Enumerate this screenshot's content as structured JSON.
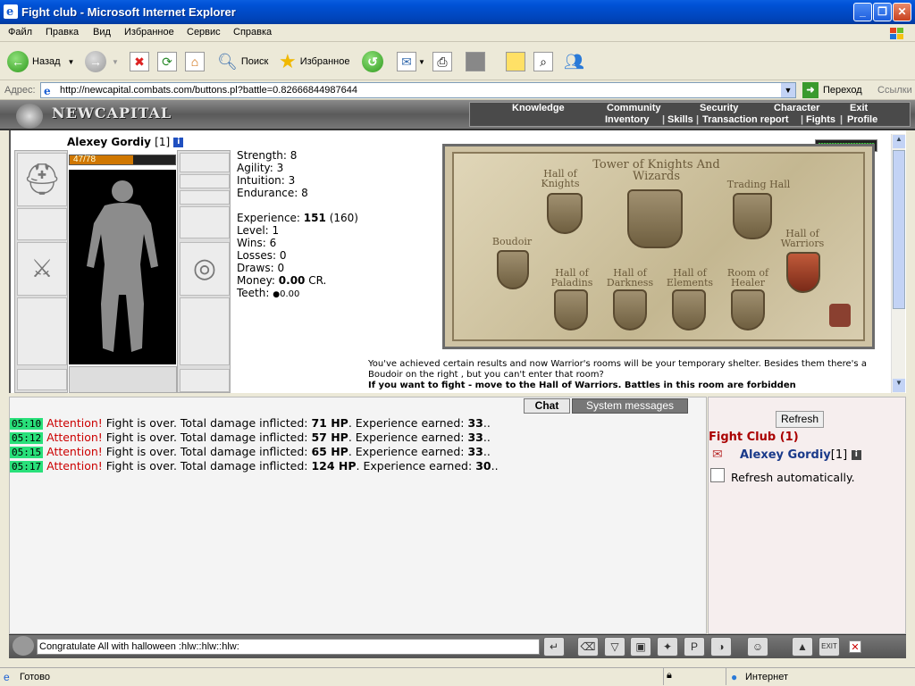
{
  "window": {
    "title": "Fight club - Microsoft Internet Explorer"
  },
  "menu": [
    "Файл",
    "Правка",
    "Вид",
    "Избранное",
    "Сервис",
    "Справка"
  ],
  "toolbar": {
    "back": "Назад",
    "search": "Поиск",
    "favorites": "Избранное"
  },
  "address": {
    "label": "Адрес:",
    "url": "http://newcapital.combats.com/buttons.pl?battle=0.82666844987644",
    "go": "Переход",
    "links": "Ссылки"
  },
  "game": {
    "logo": "NEWCAPITAL",
    "nav_top": [
      "Knowledge",
      "Community",
      "Security",
      "Character",
      "Exit"
    ],
    "nav_sub": [
      "Inventory",
      "Skills",
      "Transaction report",
      "Fights",
      "Profile"
    ]
  },
  "character": {
    "name": "Alexey Gordiy",
    "level_tag": "[1]",
    "hp": "47/78",
    "hp_ratio": 0.6,
    "stats": {
      "strength": "Strength: 8",
      "agility": "Agility: 3",
      "intuition": "Intuition: 3",
      "endurance": "Endurance: 8"
    },
    "experience_label": "Experience:",
    "experience": "151",
    "experience_next": "(160)",
    "level": "Level: 1",
    "wins": "Wins: 6",
    "losses": "Losses: 0",
    "draws": "Draws: 0",
    "money_label": "Money:",
    "money": "0.00",
    "money_unit": "CR.",
    "teeth_label": "Teeth:",
    "teeth": "0.00"
  },
  "map": {
    "rooms": {
      "knights": "Hall of Knights",
      "tower": "Tower of Knights And Wizards",
      "trading": "Trading Hall",
      "boudoir": "Boudoir",
      "warriors": "Hall of Warriors",
      "paladins": "Hall of Paladins",
      "darkness": "Hall of Darkness",
      "elements": "Hall of Elements",
      "healer": "Room of Healer"
    },
    "message": "You've achieved certain results and now Warrior's rooms will be your temporary shelter. Besides them there's a Boudoir on the right , but you can't enter that room?",
    "message_bold": "If you want to fight - move to the Hall of Warriors. Battles in this room are forbidden"
  },
  "chat": {
    "tabs": {
      "chat": "Chat",
      "system": "System messages"
    },
    "lines": [
      {
        "time": "05:10",
        "att": "Attention!",
        "t1": "Fight is over. Total damage inflicted:",
        "dmg": "71 HP",
        "t2": ". Experience earned:",
        "exp": "33",
        "t3": ".."
      },
      {
        "time": "05:12",
        "att": "Attention!",
        "t1": "Fight is over. Total damage inflicted:",
        "dmg": "57 HP",
        "t2": ". Experience earned:",
        "exp": "33",
        "t3": ".."
      },
      {
        "time": "05:15",
        "att": "Attention!",
        "t1": "Fight is over. Total damage inflicted:",
        "dmg": "65 HP",
        "t2": ". Experience earned:",
        "exp": "33",
        "t3": ".."
      },
      {
        "time": "05:17",
        "att": "Attention!",
        "t1": "Fight is over. Total damage inflicted:",
        "dmg": "124 HP",
        "t2": ". Experience earned:",
        "exp": "30",
        "t3": ".."
      }
    ],
    "input": "Congratulate All with halloween :hlw::hlw::hlw:"
  },
  "room_panel": {
    "refresh": "Refresh",
    "title": "Fight Club (1)",
    "user": "Alexey Gordiy",
    "user_level": "[1]",
    "auto": "Refresh automatically."
  },
  "status": {
    "text": "Готово",
    "zone": "Интернет"
  },
  "colors": {
    "titlebar": "#0052d6",
    "hp_fill": "#d07700",
    "time_bg": "#29e07a",
    "attention": "#cc0000",
    "club_title": "#aa0000"
  }
}
